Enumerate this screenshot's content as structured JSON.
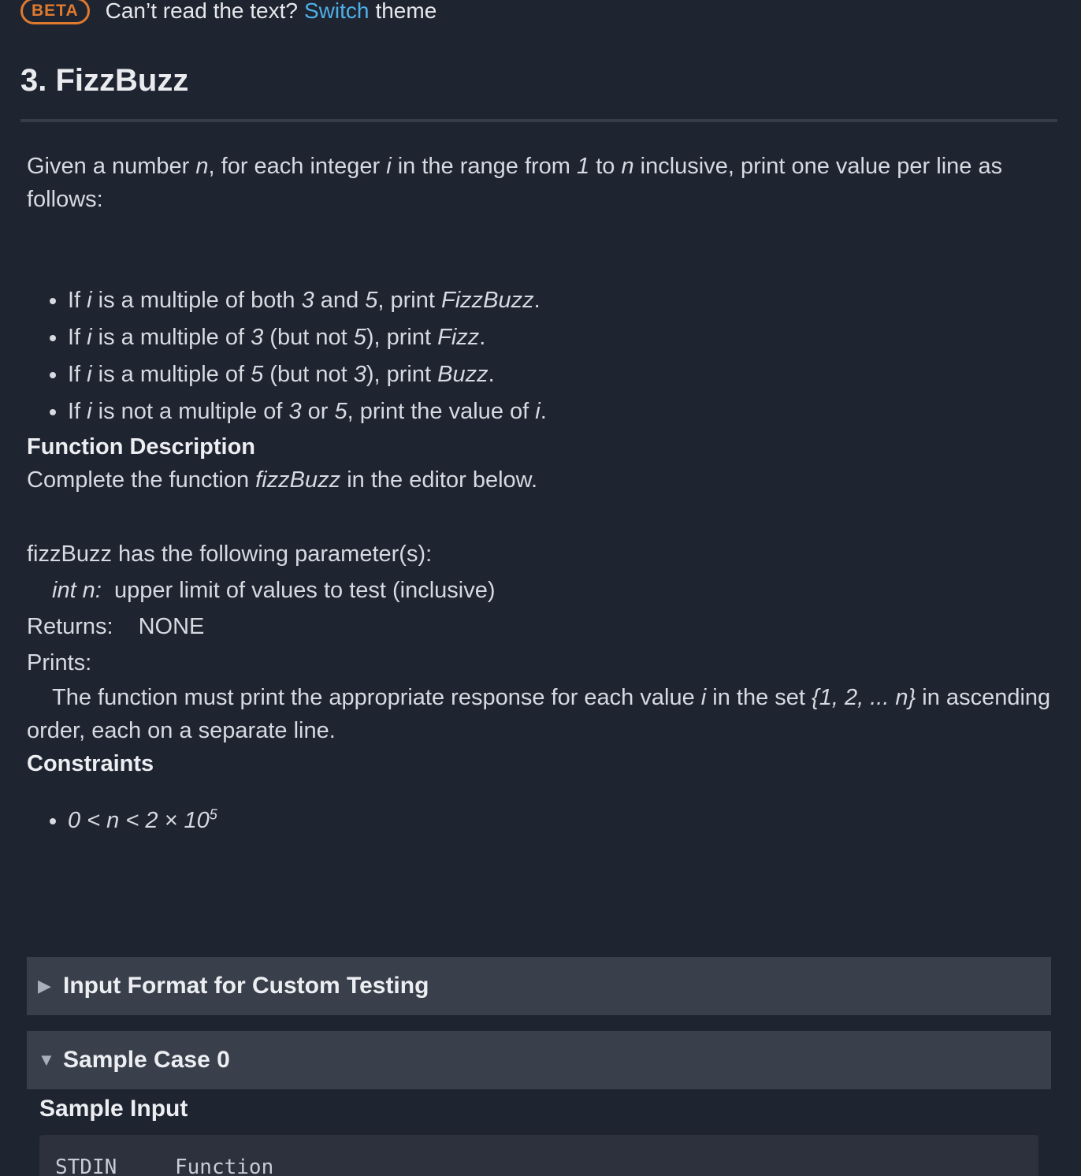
{
  "banner": {
    "badge": "BETA",
    "text_before": "Can’t read the text?",
    "link": "Switch",
    "text_after": "theme"
  },
  "title": "3. FizzBuzz",
  "intro": {
    "t1": "Given a number ",
    "v1": "n",
    "t2": ", for each integer ",
    "v2": "i",
    "t3": " in the range from ",
    "v3": "1",
    "t4": " to ",
    "v4": "n",
    "t5": " inclusive, print one value per line as follows:"
  },
  "rules": [
    {
      "a": "If ",
      "i": "i",
      "b": " is a multiple of both ",
      "x": "3",
      "c": " and ",
      "y": "5",
      "d": ", print ",
      "out": "FizzBuzz",
      "e": "."
    },
    {
      "a": "If ",
      "i": "i",
      "b": " is a multiple of ",
      "x": "3",
      "c": " (but not ",
      "y": "5",
      "d": "), print ",
      "out": "Fizz",
      "e": "."
    },
    {
      "a": "If ",
      "i": "i",
      "b": " is a multiple of ",
      "x": "5",
      "c": " (but not ",
      "y": "3",
      "d": "), print ",
      "out": "Buzz",
      "e": "."
    },
    {
      "a": "If ",
      "i": "i",
      "b": " is not a multiple of ",
      "x": "3",
      "c": " or ",
      "y": "5",
      "d": ", print the value of ",
      "out": "i",
      "e": "."
    }
  ],
  "function_description": {
    "heading": "Function Description",
    "line_a": "Complete the function ",
    "fn": "fizzBuzz",
    "line_b": " in the editor below.",
    "params_intro": "fizzBuzz has the following parameter(s):",
    "param_name": "int n:",
    "param_desc": "upper limit of values to test (inclusive)",
    "returns_label": "Returns:",
    "returns_value": "NONE",
    "prints_label": "Prints:",
    "prints_a": "The function must print the appropriate response for each value ",
    "prints_i": "i",
    "prints_b": " in the set ",
    "prints_set": "{1, 2, ... n}",
    "prints_c": " in ascending order, each on a separate line."
  },
  "constraints": {
    "heading": "Constraints",
    "item_base": "0 < n < 2 × 10",
    "item_exp": "5"
  },
  "input_format": {
    "label": "Input Format for Custom Testing",
    "caret": "▶"
  },
  "sample_case": {
    "label": "Sample Case 0",
    "caret": "▼",
    "input_heading": "Sample Input",
    "col1": "STDIN",
    "col2": "Function"
  }
}
